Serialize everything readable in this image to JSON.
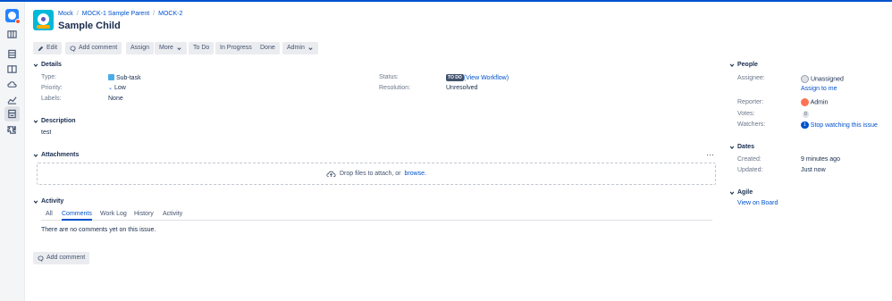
{
  "breadcrumb": [
    "Mock",
    "MOCK-1 Sample Parent",
    "MOCK-2"
  ],
  "issue_title": "Sample Child",
  "toolbar": {
    "edit": "Edit",
    "add_comment": "Add comment",
    "assign": "Assign",
    "more": "More",
    "to_do": "To Do",
    "in_progress": "In Progress",
    "done": "Done",
    "admin": "Admin"
  },
  "details": {
    "heading": "Details",
    "type_label": "Type:",
    "type_value": "Sub-task",
    "priority_label": "Priority:",
    "priority_value": "Low",
    "labels_label": "Labels:",
    "labels_value": "None",
    "status_label": "Status:",
    "status_lozenge": "TO DO",
    "status_link": "(View Workflow)",
    "resolution_label": "Resolution:",
    "resolution_value": "Unresolved"
  },
  "description": {
    "heading": "Description",
    "text": "test"
  },
  "attachments": {
    "heading": "Attachments",
    "more": "⋯",
    "drop_text": "Drop files to attach, or",
    "browse": "browse."
  },
  "activity": {
    "heading": "Activity",
    "tabs": [
      "All",
      "Comments",
      "Work Log",
      "History",
      "Activity"
    ],
    "empty_text": "There are no comments yet on this issue."
  },
  "bottom_add_comment": "Add comment",
  "people": {
    "heading": "People",
    "assignee_label": "Assignee:",
    "assignee_value": "Unassigned",
    "assign_to_me": "Assign to me",
    "reporter_label": "Reporter:",
    "reporter_value": "Admin",
    "votes_label": "Votes:",
    "votes_value": "0",
    "watchers_label": "Watchers:",
    "watchers_count": "1",
    "watchers_link": "Stop watching this issue"
  },
  "dates": {
    "heading": "Dates",
    "created_label": "Created:",
    "created_value": "9 minutes ago",
    "updated_label": "Updated:",
    "updated_value": "Just now"
  },
  "agile": {
    "heading": "Agile",
    "link": "View on Board"
  },
  "colors": {
    "accent": "#0052cc",
    "topbar": "#0052cc",
    "sidebar": "#f4f5f7"
  },
  "icons": [
    "app-logo-icon",
    "board-icon",
    "backlog-icon",
    "reports-icon",
    "releases-icon",
    "chart-icon",
    "issues-icon",
    "components-icon"
  ]
}
